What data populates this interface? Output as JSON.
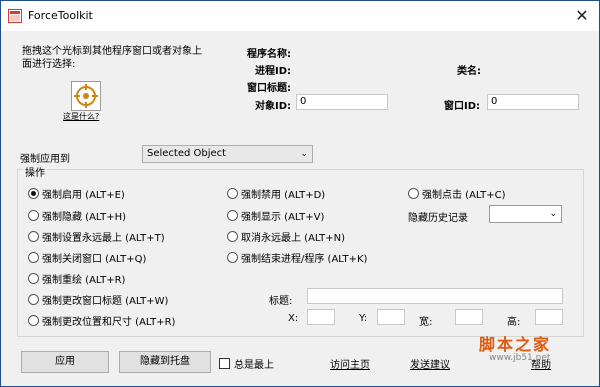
{
  "window": {
    "title": "ForceToolkit",
    "close_glyph": "✕"
  },
  "finder": {
    "instruction": "拖拽这个光标到其他程序窗口或者对象上面进行选择:",
    "what_link": "这是什么?"
  },
  "info": {
    "program_name_label": "程序名称:",
    "process_id_label": "进程ID:",
    "window_title_label": "窗口标题:",
    "object_id_label": "对象ID:",
    "object_id_value": "0",
    "class_name_label": "类名:",
    "window_id_label": "窗口ID:",
    "window_id_value": "0"
  },
  "apply_to": {
    "label": "强制应用到",
    "selected": "Selected Object"
  },
  "operations": {
    "title": "操作",
    "col1": [
      "强制启用 (ALT+E)",
      "强制隐藏 (ALT+H)",
      "强制设置永远最上 (ALT+T)",
      "强制关闭窗口 (ALT+Q)",
      "强制重绘 (ALT+R)",
      "强制更改窗口标题 (ALT+W)",
      "强制更改位置和尺寸 (ALT+R)"
    ],
    "col2": [
      "强制禁用 (ALT+D)",
      "强制显示 (ALT+V)",
      "取消永远最上 (ALT+N)",
      "强制结束进程/程序 (ALT+K)"
    ],
    "col3": [
      "强制点击 (ALT+C)"
    ],
    "hide_history_label": "隐藏历史记录",
    "hide_history_value": "",
    "title_label": "标题:",
    "title_value": "",
    "x_label": "X:",
    "y_label": "Y:",
    "w_label": "宽:",
    "h_label": "高:"
  },
  "footer": {
    "apply_button": "应用",
    "tray_button": "隐藏到托盘",
    "topmost_label": "总是最上",
    "homepage_link": "访问主页",
    "feedback_link": "发送建议",
    "help_link": "帮助"
  },
  "watermark": {
    "main": "脚本之家",
    "sub": "www.jb51.net"
  },
  "colors": {
    "accent": "#1f4e8a",
    "watermark": "#e05a10"
  }
}
